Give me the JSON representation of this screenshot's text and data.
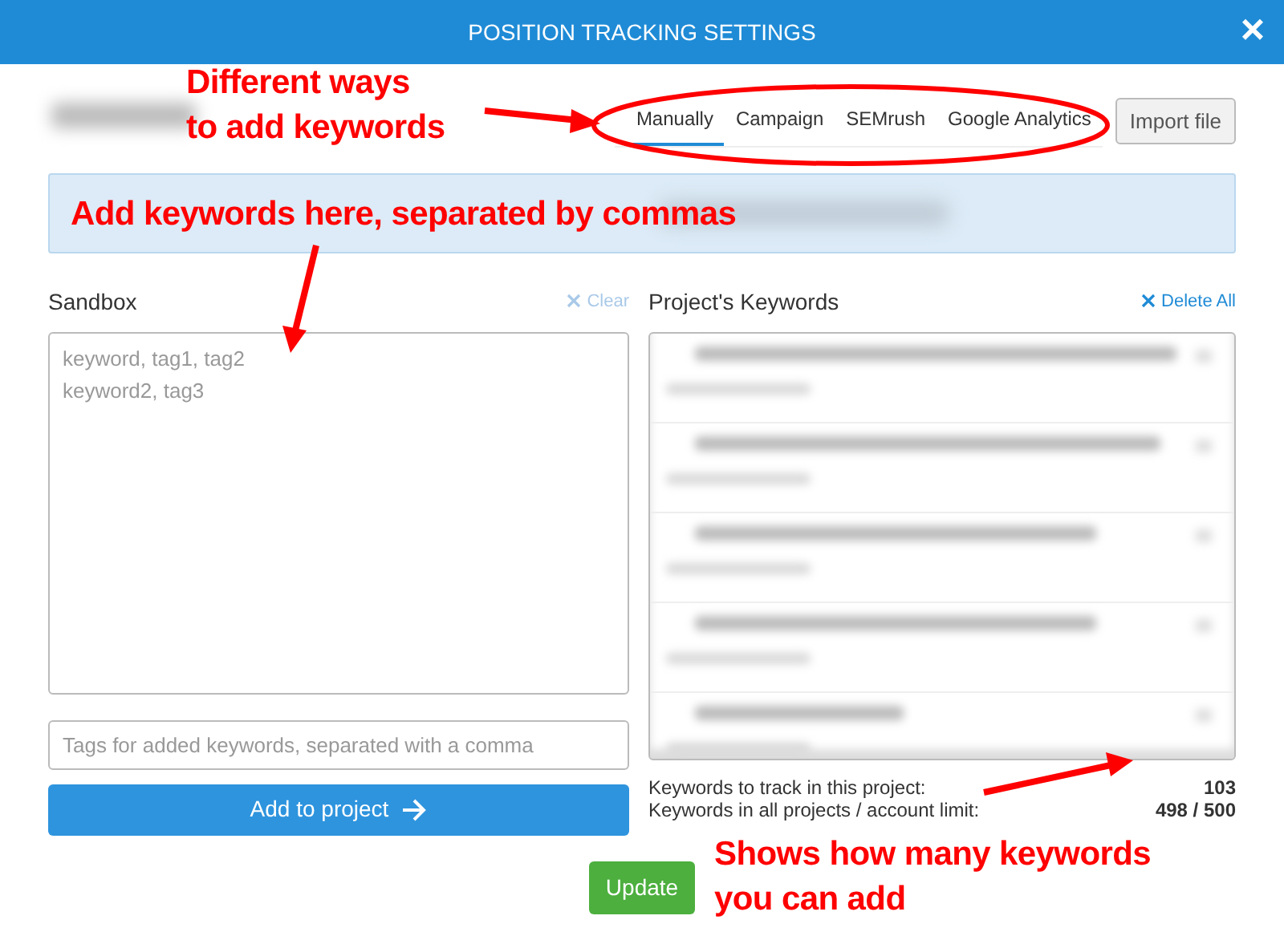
{
  "window": {
    "title": "POSITION TRACKING SETTINGS",
    "close": "×"
  },
  "tabs": [
    {
      "label": "Manually",
      "selected": true
    },
    {
      "label": "Campaign",
      "selected": false
    },
    {
      "label": "SEMrush",
      "selected": false
    },
    {
      "label": "Google Analytics",
      "selected": false
    }
  ],
  "import_button": "Import file",
  "sandbox": {
    "title": "Sandbox",
    "clear": "Clear",
    "placeholder": "keyword, tag1, tag2\nkeyword2, tag3",
    "tags_placeholder": "Tags for added keywords, separated with a comma",
    "add_button": "Add to project"
  },
  "project_keywords": {
    "title": "Project's Keywords",
    "delete_all": "Delete All",
    "rows": [
      {
        "blurred": true
      },
      {
        "blurred": true
      },
      {
        "blurred": true
      },
      {
        "blurred": true
      },
      {
        "blurred": true
      }
    ]
  },
  "stats": [
    {
      "label": "Keywords to track in this project:",
      "value": "103"
    },
    {
      "label": "Keywords in all projects / account limit:",
      "value": "498 / 500"
    }
  ],
  "update_button": "Update",
  "annotations": [
    {
      "text": "Different ways\nto add keywords"
    },
    {
      "text": "Add keywords here, separated by commas"
    },
    {
      "text": "Shows how many keywords\nyou can add"
    }
  ]
}
